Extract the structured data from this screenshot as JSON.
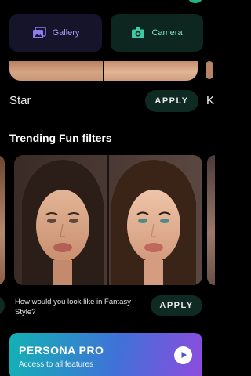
{
  "source_buttons": {
    "gallery": {
      "label": "Gallery",
      "icon": "gallery-icon",
      "color": "#a89cf5"
    },
    "camera": {
      "label": "Camera",
      "icon": "camera-icon",
      "color": "#7fe3c6"
    }
  },
  "current_filter": {
    "name": "Star",
    "apply_label": "APPLY",
    "next_peek_letter": "K"
  },
  "trending": {
    "title": "Trending Fun filters",
    "card": {
      "description": "How would you look like in Fantasy Style?",
      "apply_label": "APPLY"
    }
  },
  "promo": {
    "title": "PERSONA PRO",
    "subtitle": "Access to all features",
    "icon": "play-icon"
  },
  "colors": {
    "background": "#000000",
    "apply_button_bg": "#0f2a22",
    "accent_green": "#1fb884",
    "promo_gradient": [
      "#12b2b4",
      "#3f72d8",
      "#8e4bde"
    ]
  }
}
